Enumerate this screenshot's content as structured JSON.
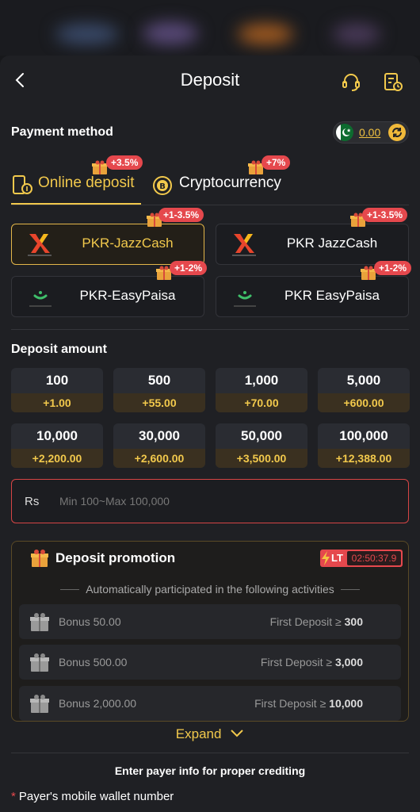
{
  "header": {
    "title": "Deposit"
  },
  "payment": {
    "label": "Payment method",
    "balance": "0.00"
  },
  "tabs": [
    {
      "label": "Online deposit",
      "badge": "+3.5%"
    },
    {
      "label": "Cryptocurrency",
      "badge": "+7%"
    }
  ],
  "methods": [
    {
      "label": "PKR-JazzCash",
      "badge": "+1-3.5%"
    },
    {
      "label": "PKR JazzCash",
      "badge": "+1-3.5%"
    },
    {
      "label": "PKR-EasyPaisa",
      "badge": "+1-2%"
    },
    {
      "label": "PKR EasyPaisa",
      "badge": "+1-2%"
    }
  ],
  "amount": {
    "label": "Deposit amount",
    "options": [
      {
        "value": "100",
        "bonus": "+1.00"
      },
      {
        "value": "500",
        "bonus": "+55.00"
      },
      {
        "value": "1,000",
        "bonus": "+70.00"
      },
      {
        "value": "5,000",
        "bonus": "+600.00"
      },
      {
        "value": "10,000",
        "bonus": "+2,200.00"
      },
      {
        "value": "30,000",
        "bonus": "+2,600.00"
      },
      {
        "value": "50,000",
        "bonus": "+3,500.00"
      },
      {
        "value": "100,000",
        "bonus": "+12,388.00"
      }
    ],
    "currency": "Rs",
    "placeholder": "Min 100~Max 100,000"
  },
  "promotion": {
    "title": "Deposit promotion",
    "timer_label": "LT",
    "timer": "02:50:37.9",
    "subtitle": "Automatically participated in the following activities",
    "rows": [
      {
        "bonus": "Bonus 50.00",
        "condition": "First Deposit ≥",
        "threshold": "300"
      },
      {
        "bonus": "Bonus 500.00",
        "condition": "First Deposit ≥",
        "threshold": "3,000"
      },
      {
        "bonus": "Bonus 2,000.00",
        "condition": "First Deposit ≥",
        "threshold": "10,000"
      }
    ],
    "expand": "Expand"
  },
  "payer": {
    "hint": "Enter payer info for proper crediting",
    "required_mark": "*",
    "wallet_label": "Payer's mobile wallet number"
  },
  "colors": {
    "accent": "#f2c94c",
    "badge": "#e5484d",
    "background": "#1f2024"
  },
  "icons": [
    "back-icon",
    "headset-icon",
    "records-icon",
    "pakistan-flag-icon",
    "refresh-icon",
    "phone-deposit-icon",
    "bitcoin-icon",
    "gift-icon",
    "jazzcash-logo-icon",
    "easypaisa-logo-icon",
    "gift-box-icon",
    "lightning-icon",
    "chevron-down-icon"
  ]
}
